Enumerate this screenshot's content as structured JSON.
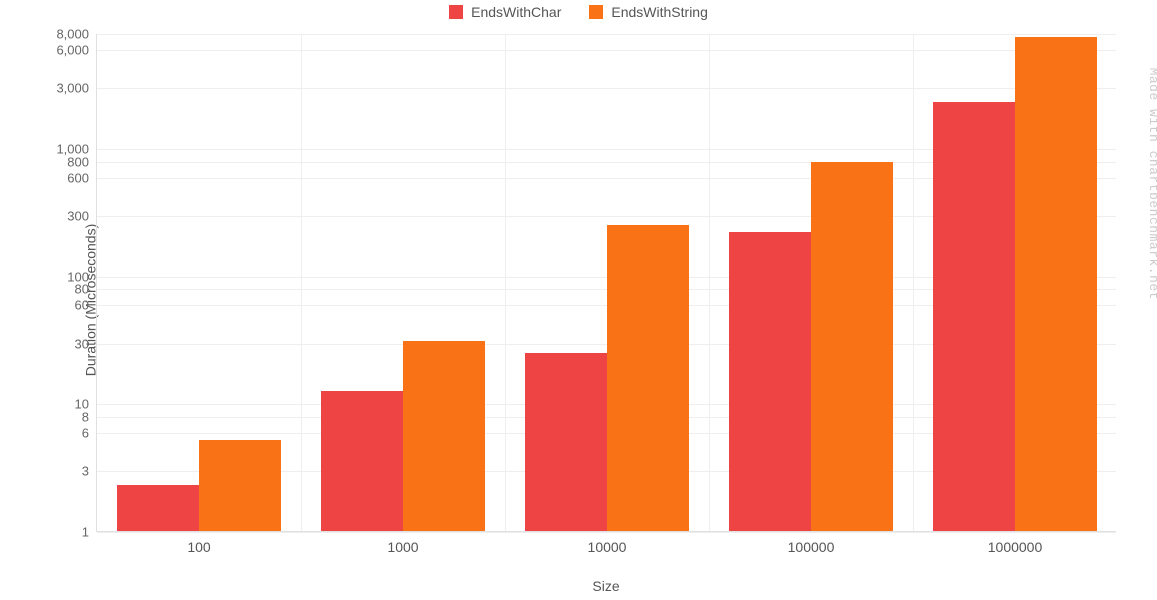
{
  "chart_data": {
    "type": "bar",
    "categories": [
      "100",
      "1000",
      "10000",
      "100000",
      "1000000"
    ],
    "series": [
      {
        "name": "EndsWithChar",
        "color": "#ef4444",
        "values": [
          2.3,
          12.5,
          25,
          220,
          2300
        ]
      },
      {
        "name": "EndsWithString",
        "color": "#f97316",
        "values": [
          5.2,
          31,
          250,
          780,
          7500
        ]
      }
    ],
    "title": "",
    "xlabel": "Size",
    "ylabel": "Duration (Microseconds)",
    "ylim": [
      1,
      8000
    ],
    "yscale": "log",
    "y_ticks": [
      1,
      3,
      6,
      8,
      10,
      30,
      60,
      80,
      100,
      300,
      600,
      800,
      1000,
      3000,
      6000,
      8000
    ],
    "y_tick_labels": [
      "1",
      "3",
      "6",
      "8",
      "10",
      "30",
      "60",
      "80",
      "100",
      "300",
      "600",
      "800",
      "1,000",
      "3,000",
      "6,000",
      "8,000"
    ],
    "watermark": "Made with chartbenchmark.net"
  }
}
